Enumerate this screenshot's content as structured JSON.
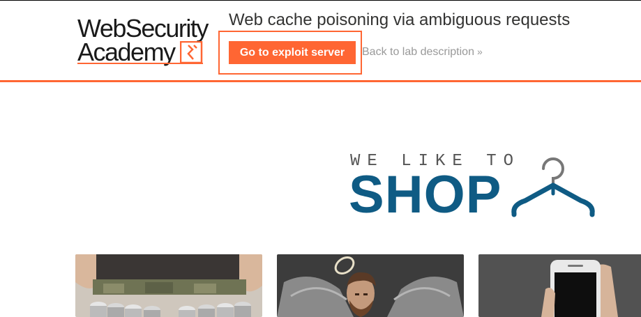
{
  "logo": {
    "line1": "WebSecurity",
    "line2": "Academy",
    "emblem_icon": "academy-flame-icon"
  },
  "header": {
    "lab_title": "Web cache poisoning via ambiguous requests",
    "exploit_button": "Go to exploit server",
    "back_link": "Back to lab description",
    "back_icon": "chevron-right-double-icon"
  },
  "banner": {
    "tagline": "WE LIKE TO",
    "headline": "SHOP",
    "hanger_icon": "coat-hanger-icon"
  },
  "products": [
    {
      "image": "product-image-1"
    },
    {
      "image": "product-image-2"
    },
    {
      "image": "product-image-3"
    }
  ],
  "colors": {
    "accent": "#ff6633",
    "shop_blue": "#0f5b84",
    "title_text": "#333332",
    "link_grey": "#999999"
  }
}
